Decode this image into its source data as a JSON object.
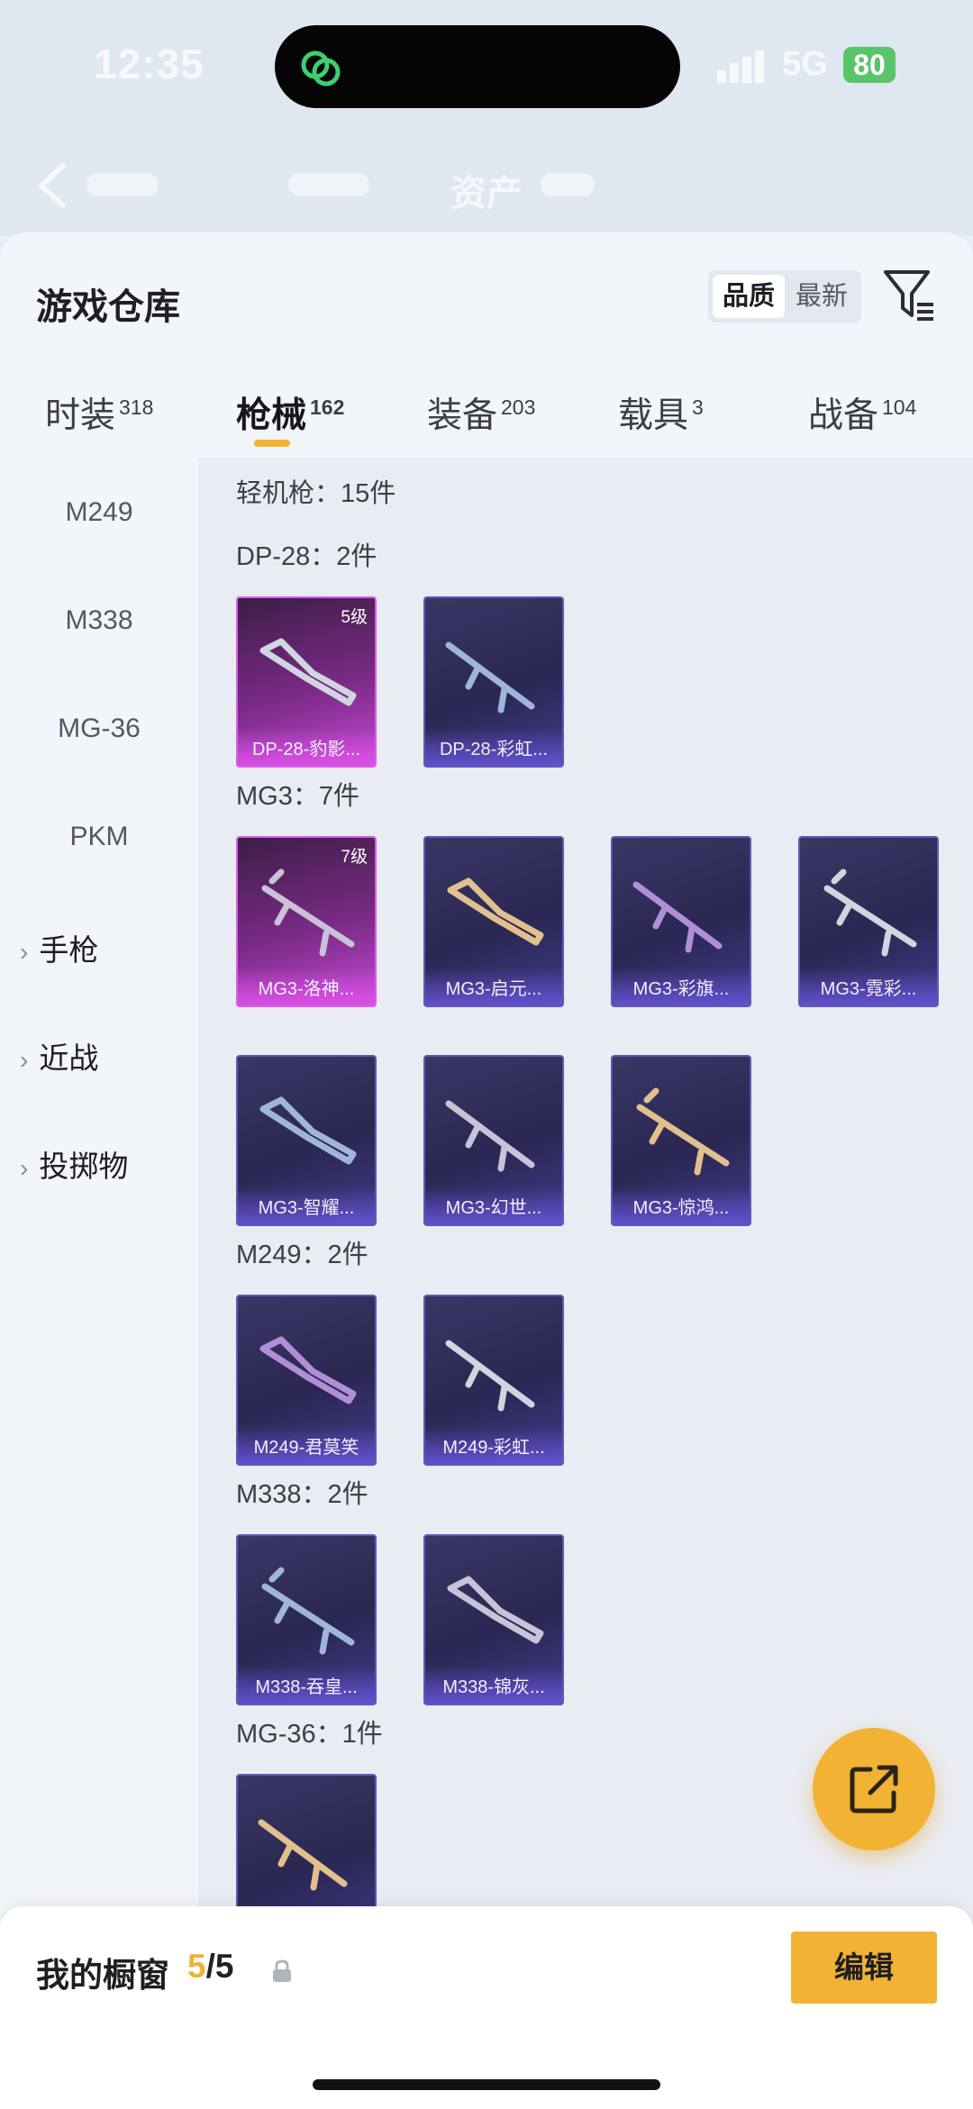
{
  "status": {
    "time": "12:35",
    "network": "5G",
    "battery": "80"
  },
  "header": {
    "title": "资产"
  },
  "sheet": {
    "title": "游戏仓库",
    "sort": {
      "active": "品质",
      "alt": "最新"
    }
  },
  "tabs": [
    {
      "label": "时装",
      "count": "318"
    },
    {
      "label": "枪械",
      "count": "162"
    },
    {
      "label": "装备",
      "count": "203"
    },
    {
      "label": "载具",
      "count": "3"
    },
    {
      "label": "战备",
      "count": "104"
    }
  ],
  "categories": {
    "items": [
      "M249",
      "M338",
      "MG-36",
      "PKM"
    ],
    "groups": [
      "手枪",
      "近战",
      "投掷物"
    ]
  },
  "content": {
    "total": "轻机枪：15件",
    "groups": [
      {
        "title": "DP-28：2件",
        "items": [
          {
            "name": "DP-28-豹影...",
            "level": "5级",
            "legend": true
          },
          {
            "name": "DP-28-彩虹...",
            "legend": false
          }
        ]
      },
      {
        "title": "MG3：7件",
        "items": [
          {
            "name": "MG3-洛神...",
            "level": "7级",
            "legend": true
          },
          {
            "name": "MG3-启元...",
            "legend": false
          },
          {
            "name": "MG3-彩旗...",
            "legend": false
          },
          {
            "name": "MG3-霓彩...",
            "legend": false
          },
          {
            "name": "MG3-智耀...",
            "legend": false
          },
          {
            "name": "MG3-幻世...",
            "legend": false
          },
          {
            "name": "MG3-惊鸿...",
            "legend": false
          }
        ]
      },
      {
        "title": "M249：2件",
        "items": [
          {
            "name": "M249-君莫笑",
            "legend": false
          },
          {
            "name": "M249-彩虹...",
            "legend": false
          }
        ]
      },
      {
        "title": "M338：2件",
        "items": [
          {
            "name": "M338-吞皇...",
            "legend": false
          },
          {
            "name": "M338-锦灰...",
            "legend": false
          }
        ]
      },
      {
        "title": "MG-36：1件",
        "items": [
          {
            "name": "",
            "legend": false
          }
        ]
      }
    ]
  },
  "bottom": {
    "label": "我的橱窗",
    "current": "5",
    "sep_total": "/5",
    "edit": "编辑"
  },
  "colors": {
    "accent": "#f2b233",
    "legend": "#c24ad3",
    "epic": "#5e58b6"
  },
  "icons": [
    "chat-bubble-icon",
    "signal-icon",
    "back-chevron-icon",
    "filter-icon",
    "lock-icon",
    "share-external-icon"
  ]
}
